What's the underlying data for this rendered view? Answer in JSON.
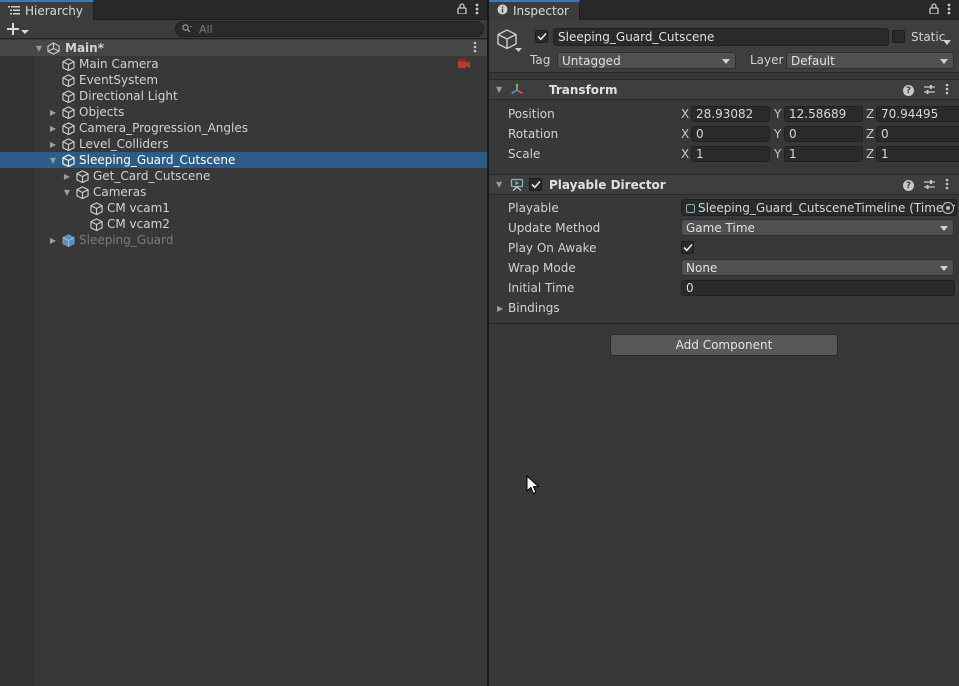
{
  "hierarchy": {
    "tab_label": "Hierarchy",
    "search_placeholder": "All",
    "scene": {
      "label": "Main*"
    },
    "items": [
      {
        "label": "Main Camera",
        "depth": 1,
        "foldout": "none",
        "state": "normal",
        "gizmo": "camera-gizmo-icon"
      },
      {
        "label": "EventSystem",
        "depth": 1,
        "foldout": "none",
        "state": "normal"
      },
      {
        "label": "Directional Light",
        "depth": 1,
        "foldout": "none",
        "state": "normal"
      },
      {
        "label": "Objects",
        "depth": 1,
        "foldout": "collapsed",
        "state": "normal"
      },
      {
        "label": "Camera_Progression_Angles",
        "depth": 1,
        "foldout": "collapsed",
        "state": "normal"
      },
      {
        "label": "Level_Colliders",
        "depth": 1,
        "foldout": "collapsed",
        "state": "normal"
      },
      {
        "label": "Sleeping_Guard_Cutscene",
        "depth": 1,
        "foldout": "expanded",
        "state": "selected"
      },
      {
        "label": "Get_Card_Cutscene",
        "depth": 2,
        "foldout": "collapsed",
        "state": "normal"
      },
      {
        "label": "Cameras",
        "depth": 2,
        "foldout": "expanded",
        "state": "normal"
      },
      {
        "label": "CM vcam1",
        "depth": 3,
        "foldout": "none",
        "state": "normal"
      },
      {
        "label": "CM vcam2",
        "depth": 3,
        "foldout": "none",
        "state": "normal"
      },
      {
        "label": "Sleeping_Guard",
        "depth": 1,
        "foldout": "collapsed",
        "state": "disabled",
        "prefab": true
      }
    ]
  },
  "inspector": {
    "tab_label": "Inspector",
    "object": {
      "active": true,
      "name": "Sleeping_Guard_Cutscene",
      "static_label": "Static",
      "static_checked": false,
      "tag_label": "Tag",
      "tag_value": "Untagged",
      "layer_label": "Layer",
      "layer_value": "Default"
    },
    "transform": {
      "title": "Transform",
      "rows": [
        {
          "label": "Position",
          "x": "28.93082",
          "y": "12.58689",
          "z": "70.94495"
        },
        {
          "label": "Rotation",
          "x": "0",
          "y": "0",
          "z": "0"
        },
        {
          "label": "Scale",
          "x": "1",
          "y": "1",
          "z": "1"
        }
      ],
      "axis_x": "X",
      "axis_y": "Y",
      "axis_z": "Z"
    },
    "playable_director": {
      "title": "Playable Director",
      "enabled": true,
      "playable_label": "Playable",
      "playable_value": "Sleeping_Guard_CutsceneTimeline (Timelir",
      "update_method_label": "Update Method",
      "update_method_value": "Game Time",
      "play_on_awake_label": "Play On Awake",
      "play_on_awake": true,
      "wrap_mode_label": "Wrap Mode",
      "wrap_mode_value": "None",
      "initial_time_label": "Initial Time",
      "initial_time_value": "0",
      "bindings_label": "Bindings"
    },
    "add_component_label": "Add Component"
  },
  "colors": {
    "selection": "#2c5d87",
    "tab_accent": "#3a79bb",
    "panel_bg": "#383838"
  }
}
